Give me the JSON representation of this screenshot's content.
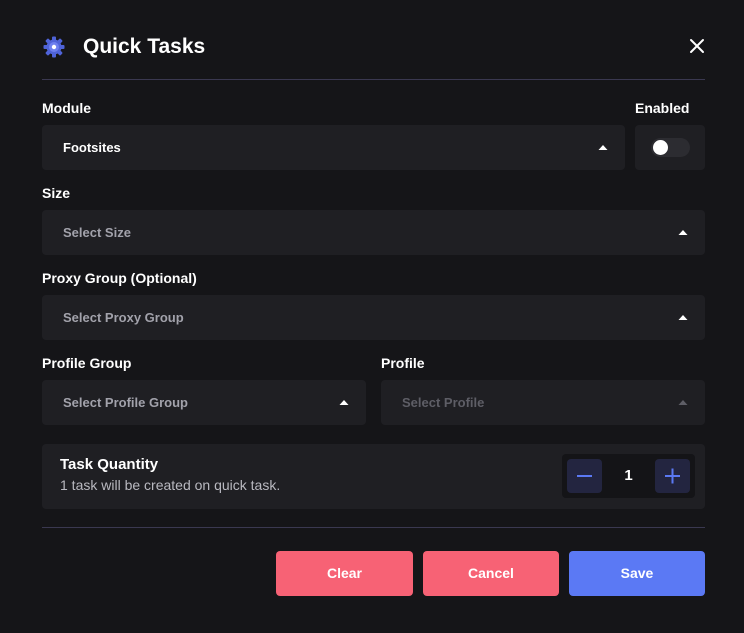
{
  "header": {
    "title": "Quick Tasks",
    "icon": "gear-icon",
    "close_icon": "close-icon"
  },
  "module": {
    "label": "Module",
    "value": "Footsites"
  },
  "enabled": {
    "label": "Enabled",
    "on": false
  },
  "size": {
    "label": "Size",
    "placeholder": "Select Size"
  },
  "proxy_group": {
    "label": "Proxy Group (Optional)",
    "placeholder": "Select Proxy Group"
  },
  "profile_group": {
    "label": "Profile Group",
    "placeholder": "Select Profile Group"
  },
  "profile": {
    "label": "Profile",
    "placeholder": "Select Profile",
    "disabled": true
  },
  "task_quantity": {
    "title": "Task Quantity",
    "subtitle": "1 task will be created on quick task.",
    "value": "1"
  },
  "buttons": {
    "clear": "Clear",
    "cancel": "Cancel",
    "save": "Save"
  },
  "colors": {
    "background": "#151518",
    "field": "#1f1f23",
    "divider": "#3a3850",
    "accent_blue": "#5b79f4",
    "danger_red": "#f76275",
    "stepper_button": "#232540"
  }
}
